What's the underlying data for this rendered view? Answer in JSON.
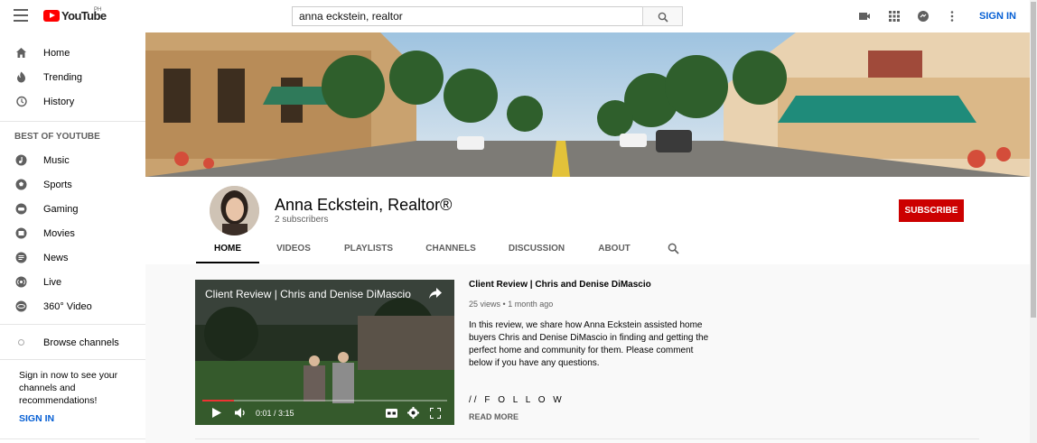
{
  "app": {
    "logo_text": "YouTube",
    "region": "PH"
  },
  "search": {
    "value": "anna eckstein, realtor"
  },
  "topbar": {
    "sign_in_label": "SIGN IN"
  },
  "sidebar": {
    "primary": [
      {
        "label": "Home",
        "icon": "home-icon"
      },
      {
        "label": "Trending",
        "icon": "trending-icon"
      },
      {
        "label": "History",
        "icon": "history-icon"
      }
    ],
    "section_heading": "BEST OF YOUTUBE",
    "best": [
      {
        "label": "Music",
        "icon": "music-icon"
      },
      {
        "label": "Sports",
        "icon": "sports-icon"
      },
      {
        "label": "Gaming",
        "icon": "gaming-icon"
      },
      {
        "label": "Movies",
        "icon": "movies-icon"
      },
      {
        "label": "News",
        "icon": "news-icon"
      },
      {
        "label": "Live",
        "icon": "live-icon"
      },
      {
        "label": "360° Video",
        "icon": "360-video-icon"
      }
    ],
    "browse_channels": "Browse channels",
    "signin_prompt": "Sign in now to see your channels and recommendations!",
    "signin_button": "SIGN IN"
  },
  "channel": {
    "name": "Anna Eckstein, Realtor®",
    "subscribers": "2 subscribers",
    "subscribe_label": "SUBSCRIBE",
    "tabs": [
      "HOME",
      "VIDEOS",
      "PLAYLISTS",
      "CHANNELS",
      "DISCUSSION",
      "ABOUT"
    ],
    "active_tab": "HOME"
  },
  "featured_video": {
    "player_title": "Client Review | Chris and Denise DiMascio",
    "current_time": "0:01 / 3:15",
    "progress": 0.005,
    "title": "Client Review | Chris and Denise DiMascio",
    "views": "25 views",
    "age": "1 month ago",
    "description": "In this review, we share how Anna Eckstein assisted home buyers Chris and Denise DiMascio in finding and getting the perfect home and community for them. Please comment below if you have any questions.",
    "follow": "// F O L L O W",
    "read_more": "READ MORE"
  },
  "colors": {
    "brand_red": "#ff0000",
    "subscribe_red": "#cc0000",
    "link_blue": "#065fd4"
  }
}
